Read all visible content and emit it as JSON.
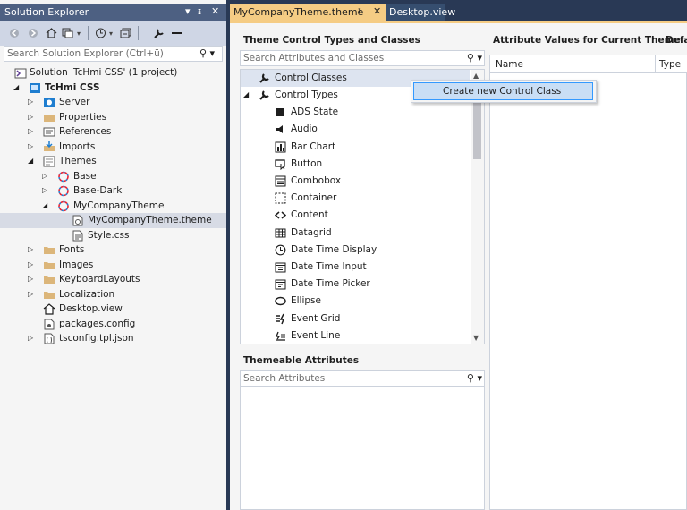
{
  "solution_explorer": {
    "title": "Solution Explorer",
    "search_placeholder": "Search Solution Explorer (Ctrl+ü)",
    "tree": [
      {
        "label": "Solution 'TcHmi CSS' (1 project)",
        "icon": "solution-icon",
        "bold": false
      },
      {
        "label": "TcHmi CSS",
        "icon": "hmi-project-icon",
        "bold": true
      },
      {
        "label": "Server",
        "icon": "server-icon"
      },
      {
        "label": "Properties",
        "icon": "folder-icon"
      },
      {
        "label": "References",
        "icon": "references-icon"
      },
      {
        "label": "Imports",
        "icon": "imports-icon"
      },
      {
        "label": "Themes",
        "icon": "themes-icon"
      },
      {
        "label": "Base",
        "icon": "theme-icon"
      },
      {
        "label": "Base-Dark",
        "icon": "theme-icon"
      },
      {
        "label": "MyCompanyTheme",
        "icon": "theme-icon"
      },
      {
        "label": "MyCompanyTheme.theme",
        "icon": "theme-file-icon",
        "selected": true
      },
      {
        "label": "Style.css",
        "icon": "css-file-icon"
      },
      {
        "label": "Fonts",
        "icon": "folder-icon"
      },
      {
        "label": "Images",
        "icon": "folder-icon"
      },
      {
        "label": "KeyboardLayouts",
        "icon": "folder-icon"
      },
      {
        "label": "Localization",
        "icon": "folder-icon"
      },
      {
        "label": "Desktop.view",
        "icon": "home-view-icon"
      },
      {
        "label": "packages.config",
        "icon": "config-file-icon"
      },
      {
        "label": "tsconfig.tpl.json",
        "icon": "json-file-icon"
      }
    ]
  },
  "tabs": [
    {
      "label": "MyCompanyTheme.theme",
      "active": true
    },
    {
      "label": "Desktop.view",
      "active": false
    }
  ],
  "editor": {
    "types_heading": "Theme Control Types and Classes",
    "types_search_placeholder": "Search Attributes and Classes",
    "types_list": [
      {
        "label": "Control Classes",
        "icon": "wrench-icon"
      },
      {
        "label": "Control Types",
        "icon": "wrench-icon"
      },
      {
        "label": "ADS State",
        "icon": "ads-state-icon"
      },
      {
        "label": "Audio",
        "icon": "audio-icon"
      },
      {
        "label": "Bar Chart",
        "icon": "bar-chart-icon"
      },
      {
        "label": "Button",
        "icon": "button-icon"
      },
      {
        "label": "Combobox",
        "icon": "combobox-icon"
      },
      {
        "label": "Container",
        "icon": "container-icon"
      },
      {
        "label": "Content",
        "icon": "content-icon"
      },
      {
        "label": "Datagrid",
        "icon": "datagrid-icon"
      },
      {
        "label": "Date Time Display",
        "icon": "clock-icon"
      },
      {
        "label": "Date Time Input",
        "icon": "date-input-icon"
      },
      {
        "label": "Date Time Picker",
        "icon": "date-picker-icon"
      },
      {
        "label": "Ellipse",
        "icon": "ellipse-icon"
      },
      {
        "label": "Event Grid",
        "icon": "event-grid-icon"
      },
      {
        "label": "Event Line",
        "icon": "event-line-icon"
      }
    ],
    "attrs_heading": "Themeable Attributes",
    "attrs_search_placeholder": "Search Attributes",
    "values_heading": "Attribute Values for Current Theme",
    "values_heading_extra": "Defa",
    "grid_columns": [
      "Name",
      "Type"
    ]
  },
  "context_menu": {
    "items": [
      "Create new Control Class"
    ]
  }
}
